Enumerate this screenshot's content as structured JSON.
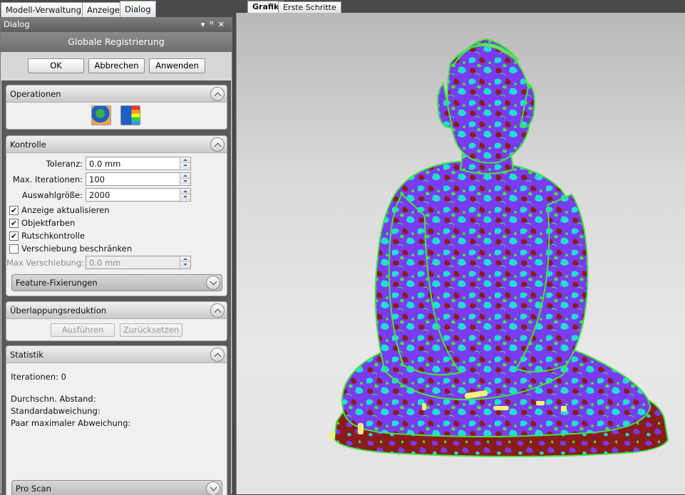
{
  "dock_tabs": [
    "Modell-Verwaltung",
    "Anzeige",
    "Dialog"
  ],
  "panel_title": "Dialog",
  "dialog_header": "Globale Registrierung",
  "buttons": {
    "ok": "OK",
    "cancel": "Abbrechen",
    "apply": "Anwenden"
  },
  "operations": {
    "title": "Operationen",
    "icons": [
      "globe-register-icon",
      "globe-colormap-icon"
    ]
  },
  "control": {
    "title": "Kontrolle",
    "tolerance_label": "Toleranz:",
    "tolerance_value": "0.0 mm",
    "max_iter_label": "Max. Iterationen:",
    "max_iter_value": "100",
    "sample_label": "Auswahlgröße:",
    "sample_value": "2000",
    "checkboxes": [
      {
        "label": "Anzeige aktualisieren",
        "checked": true
      },
      {
        "label": "Objektfarben",
        "checked": true
      },
      {
        "label": "Rutschkontrolle",
        "checked": true
      },
      {
        "label": "Verschiebung beschränken",
        "checked": false
      }
    ],
    "max_shift_label": "Max Verschiebung:",
    "max_shift_value": "0.0 mm",
    "feature_label": "Feature-Fixierungen"
  },
  "overlap": {
    "title": "Überlappungsreduktion",
    "run": "Ausführen",
    "reset": "Zurücksetzen"
  },
  "stats": {
    "title": "Statistik",
    "iterations": "Iterationen: 0",
    "avg_distance": "Durchschn. Abstand:",
    "std_dev": "Standardabweichung:",
    "pair_max": "Paar maximaler Abweichung:"
  },
  "pro_scan": "Pro Scan",
  "right_tabs": [
    "Grafik",
    "Erste Schritte"
  ],
  "colors": {
    "mesh_purple": "#7a3cf0",
    "mesh_cyan": "#1fe0d0",
    "mesh_red": "#8a1c1c",
    "mesh_green": "#3ee63e",
    "mesh_yellow": "#f4f27a"
  }
}
